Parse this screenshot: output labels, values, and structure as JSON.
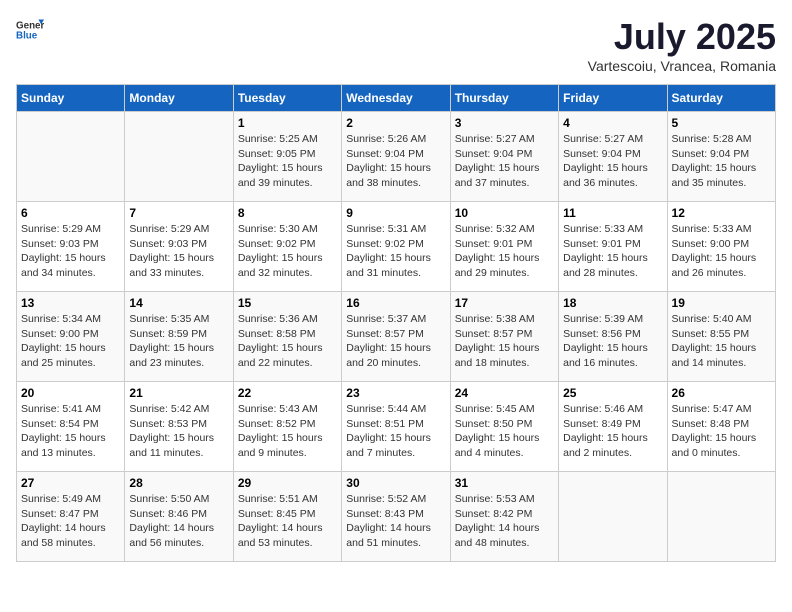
{
  "header": {
    "logo_general": "General",
    "logo_blue": "Blue",
    "month_title": "July 2025",
    "subtitle": "Vartescoiu, Vrancea, Romania"
  },
  "weekdays": [
    "Sunday",
    "Monday",
    "Tuesday",
    "Wednesday",
    "Thursday",
    "Friday",
    "Saturday"
  ],
  "weeks": [
    [
      {
        "day": "",
        "sunrise": "",
        "sunset": "",
        "daylight": ""
      },
      {
        "day": "",
        "sunrise": "",
        "sunset": "",
        "daylight": ""
      },
      {
        "day": "1",
        "sunrise": "Sunrise: 5:25 AM",
        "sunset": "Sunset: 9:05 PM",
        "daylight": "Daylight: 15 hours and 39 minutes."
      },
      {
        "day": "2",
        "sunrise": "Sunrise: 5:26 AM",
        "sunset": "Sunset: 9:04 PM",
        "daylight": "Daylight: 15 hours and 38 minutes."
      },
      {
        "day": "3",
        "sunrise": "Sunrise: 5:27 AM",
        "sunset": "Sunset: 9:04 PM",
        "daylight": "Daylight: 15 hours and 37 minutes."
      },
      {
        "day": "4",
        "sunrise": "Sunrise: 5:27 AM",
        "sunset": "Sunset: 9:04 PM",
        "daylight": "Daylight: 15 hours and 36 minutes."
      },
      {
        "day": "5",
        "sunrise": "Sunrise: 5:28 AM",
        "sunset": "Sunset: 9:04 PM",
        "daylight": "Daylight: 15 hours and 35 minutes."
      }
    ],
    [
      {
        "day": "6",
        "sunrise": "Sunrise: 5:29 AM",
        "sunset": "Sunset: 9:03 PM",
        "daylight": "Daylight: 15 hours and 34 minutes."
      },
      {
        "day": "7",
        "sunrise": "Sunrise: 5:29 AM",
        "sunset": "Sunset: 9:03 PM",
        "daylight": "Daylight: 15 hours and 33 minutes."
      },
      {
        "day": "8",
        "sunrise": "Sunrise: 5:30 AM",
        "sunset": "Sunset: 9:02 PM",
        "daylight": "Daylight: 15 hours and 32 minutes."
      },
      {
        "day": "9",
        "sunrise": "Sunrise: 5:31 AM",
        "sunset": "Sunset: 9:02 PM",
        "daylight": "Daylight: 15 hours and 31 minutes."
      },
      {
        "day": "10",
        "sunrise": "Sunrise: 5:32 AM",
        "sunset": "Sunset: 9:01 PM",
        "daylight": "Daylight: 15 hours and 29 minutes."
      },
      {
        "day": "11",
        "sunrise": "Sunrise: 5:33 AM",
        "sunset": "Sunset: 9:01 PM",
        "daylight": "Daylight: 15 hours and 28 minutes."
      },
      {
        "day": "12",
        "sunrise": "Sunrise: 5:33 AM",
        "sunset": "Sunset: 9:00 PM",
        "daylight": "Daylight: 15 hours and 26 minutes."
      }
    ],
    [
      {
        "day": "13",
        "sunrise": "Sunrise: 5:34 AM",
        "sunset": "Sunset: 9:00 PM",
        "daylight": "Daylight: 15 hours and 25 minutes."
      },
      {
        "day": "14",
        "sunrise": "Sunrise: 5:35 AM",
        "sunset": "Sunset: 8:59 PM",
        "daylight": "Daylight: 15 hours and 23 minutes."
      },
      {
        "day": "15",
        "sunrise": "Sunrise: 5:36 AM",
        "sunset": "Sunset: 8:58 PM",
        "daylight": "Daylight: 15 hours and 22 minutes."
      },
      {
        "day": "16",
        "sunrise": "Sunrise: 5:37 AM",
        "sunset": "Sunset: 8:57 PM",
        "daylight": "Daylight: 15 hours and 20 minutes."
      },
      {
        "day": "17",
        "sunrise": "Sunrise: 5:38 AM",
        "sunset": "Sunset: 8:57 PM",
        "daylight": "Daylight: 15 hours and 18 minutes."
      },
      {
        "day": "18",
        "sunrise": "Sunrise: 5:39 AM",
        "sunset": "Sunset: 8:56 PM",
        "daylight": "Daylight: 15 hours and 16 minutes."
      },
      {
        "day": "19",
        "sunrise": "Sunrise: 5:40 AM",
        "sunset": "Sunset: 8:55 PM",
        "daylight": "Daylight: 15 hours and 14 minutes."
      }
    ],
    [
      {
        "day": "20",
        "sunrise": "Sunrise: 5:41 AM",
        "sunset": "Sunset: 8:54 PM",
        "daylight": "Daylight: 15 hours and 13 minutes."
      },
      {
        "day": "21",
        "sunrise": "Sunrise: 5:42 AM",
        "sunset": "Sunset: 8:53 PM",
        "daylight": "Daylight: 15 hours and 11 minutes."
      },
      {
        "day": "22",
        "sunrise": "Sunrise: 5:43 AM",
        "sunset": "Sunset: 8:52 PM",
        "daylight": "Daylight: 15 hours and 9 minutes."
      },
      {
        "day": "23",
        "sunrise": "Sunrise: 5:44 AM",
        "sunset": "Sunset: 8:51 PM",
        "daylight": "Daylight: 15 hours and 7 minutes."
      },
      {
        "day": "24",
        "sunrise": "Sunrise: 5:45 AM",
        "sunset": "Sunset: 8:50 PM",
        "daylight": "Daylight: 15 hours and 4 minutes."
      },
      {
        "day": "25",
        "sunrise": "Sunrise: 5:46 AM",
        "sunset": "Sunset: 8:49 PM",
        "daylight": "Daylight: 15 hours and 2 minutes."
      },
      {
        "day": "26",
        "sunrise": "Sunrise: 5:47 AM",
        "sunset": "Sunset: 8:48 PM",
        "daylight": "Daylight: 15 hours and 0 minutes."
      }
    ],
    [
      {
        "day": "27",
        "sunrise": "Sunrise: 5:49 AM",
        "sunset": "Sunset: 8:47 PM",
        "daylight": "Daylight: 14 hours and 58 minutes."
      },
      {
        "day": "28",
        "sunrise": "Sunrise: 5:50 AM",
        "sunset": "Sunset: 8:46 PM",
        "daylight": "Daylight: 14 hours and 56 minutes."
      },
      {
        "day": "29",
        "sunrise": "Sunrise: 5:51 AM",
        "sunset": "Sunset: 8:45 PM",
        "daylight": "Daylight: 14 hours and 53 minutes."
      },
      {
        "day": "30",
        "sunrise": "Sunrise: 5:52 AM",
        "sunset": "Sunset: 8:43 PM",
        "daylight": "Daylight: 14 hours and 51 minutes."
      },
      {
        "day": "31",
        "sunrise": "Sunrise: 5:53 AM",
        "sunset": "Sunset: 8:42 PM",
        "daylight": "Daylight: 14 hours and 48 minutes."
      },
      {
        "day": "",
        "sunrise": "",
        "sunset": "",
        "daylight": ""
      },
      {
        "day": "",
        "sunrise": "",
        "sunset": "",
        "daylight": ""
      }
    ]
  ]
}
